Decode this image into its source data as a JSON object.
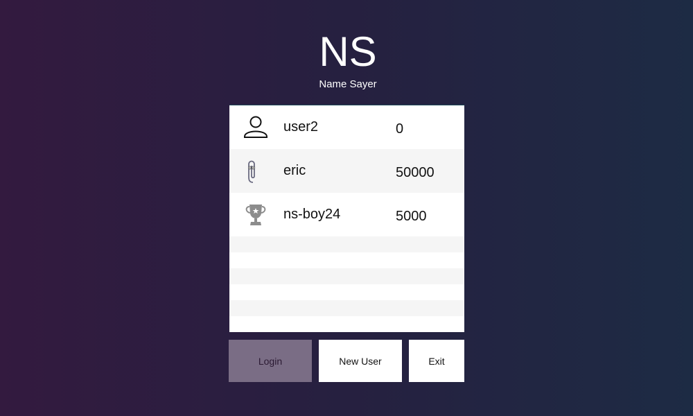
{
  "app": {
    "title": "NS",
    "subtitle": "Name Sayer"
  },
  "users": [
    {
      "name": "user2",
      "score": "0",
      "icon": "person-icon"
    },
    {
      "name": "eric",
      "score": "50000",
      "icon": "paperclip-icon"
    },
    {
      "name": "ns-boy24",
      "score": "5000",
      "icon": "trophy-icon"
    }
  ],
  "buttons": {
    "login": "Login",
    "new_user": "New User",
    "exit": "Exit"
  },
  "colors": {
    "login_button": "#7a6d85",
    "background_left": "#331a3f",
    "background_right": "#1d2b44"
  }
}
